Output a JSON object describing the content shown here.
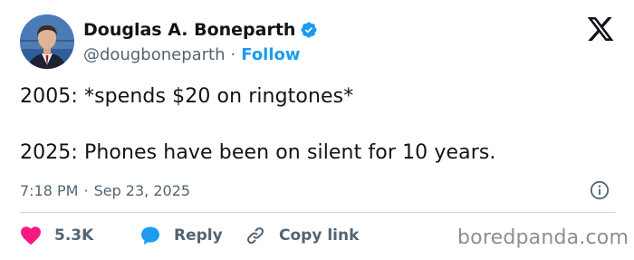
{
  "author": {
    "display_name": "Douglas A. Boneparth",
    "handle": "@dougboneparth",
    "separator": "·",
    "follow_label": "Follow",
    "verified": true
  },
  "tweet": {
    "lines": [
      "2005: *spends $20 on ringtones*",
      "2025: Phones have been on silent for 10 years."
    ],
    "time": "7:18 PM",
    "meta_separator": "·",
    "date": "Sep 23, 2025"
  },
  "actions": {
    "like_count": "5.3K",
    "reply_label": "Reply",
    "copy_link_label": "Copy link"
  },
  "watermark": "boredpanda.com",
  "icons": {
    "verified": "verified-badge-icon",
    "brand": "x-logo-icon",
    "info": "info-icon",
    "like": "heart-icon",
    "reply": "speech-bubble-icon",
    "copy": "link-icon"
  },
  "colors": {
    "accent": "#1d9bf0",
    "text": "#0f1419",
    "muted": "#536471",
    "like": "#f91880",
    "divider": "#cfd9de",
    "watermark": "#8a8f93"
  }
}
